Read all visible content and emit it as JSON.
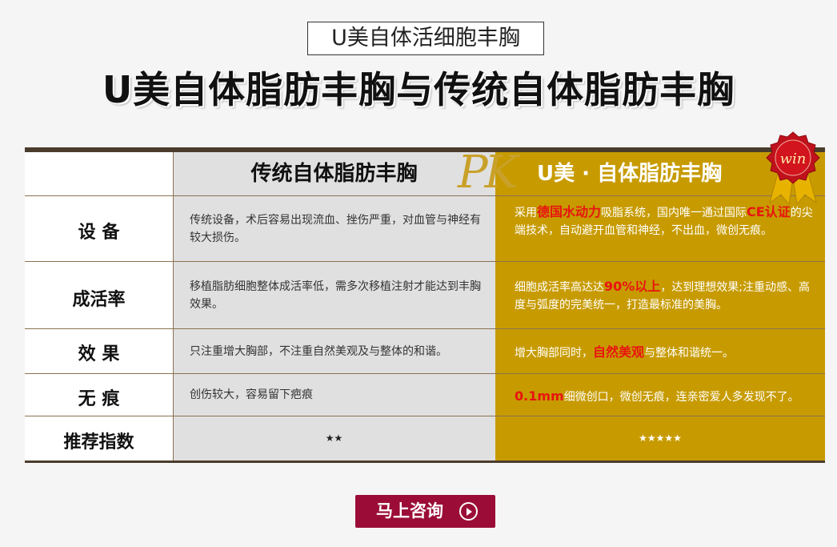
{
  "subtitle": "U美自体活细胞丰胸",
  "title": "U美自体脂肪丰胸与传统自体脂肪丰胸",
  "table": {
    "pk_label": "PK",
    "win_badge": "win",
    "header_trad": "传统自体脂肪丰胸",
    "header_u": "U美 · 自体脂肪丰胸",
    "rows": [
      {
        "label": "设  备",
        "trad": "传统设备，术后容易出现流血、挫伤严重，对血管与神经有较大损伤。",
        "u_pre1": "采用",
        "u_hl1": "德国水动力",
        "u_mid1": "吸脂系统，国内唯一通过国际",
        "u_hl2": "CE认证",
        "u_post": "的尖端技术，自动避开血管和神经，不出血，微创无痕。"
      },
      {
        "label": "成活率",
        "trad": "移植脂肪细胞整体成活率低，需多次移植注射才能达到丰胸效果。",
        "u_pre1": "细胞成活率高达达",
        "u_hl1": "90%以上",
        "u_post": "，达到理想效果;注重动感、高度与弧度的完美统一，打造最标准的美胸。"
      },
      {
        "label": "效  果",
        "trad": "只注重增大胸部，不注重自然美观及与整体的和谐。",
        "u_pre1": "增大胸部同时，",
        "u_hl1": "自然美观",
        "u_post": "与整体和谐统一。"
      },
      {
        "label": "无  痕",
        "trad": "创伤较大，容易留下疤痕",
        "u_hl1": "0.1mm",
        "u_post": "细微创口，微创无痕，连亲密爱人多发现不了。"
      },
      {
        "label": "推荐指数",
        "trad": "★★",
        "u": "★★★★★"
      }
    ]
  },
  "cta": {
    "label": "马上咨询"
  },
  "colors": {
    "gold": "#c79b00",
    "dark_brown": "#4a3c2c",
    "highlight_red": "#e8140f",
    "cta_bg": "#9b0d37"
  }
}
